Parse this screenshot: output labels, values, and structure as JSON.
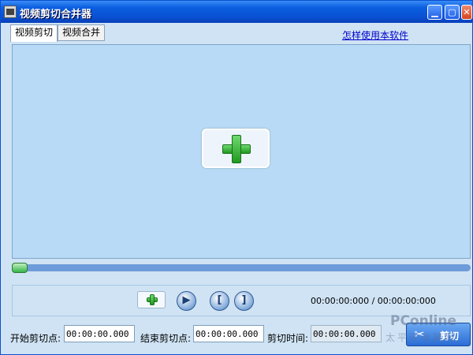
{
  "window": {
    "title": "视频剪切合并器",
    "minimize_glyph": "▁",
    "maximize_glyph": "▢",
    "close_glyph": "✕"
  },
  "tabs": [
    {
      "label": "视频剪切",
      "active": true
    },
    {
      "label": "视频合并",
      "active": false
    }
  ],
  "help_link": "怎样使用本软件",
  "video": {
    "add_icon": "plus-icon",
    "progress_fraction": 0.0
  },
  "controls": {
    "add_icon": "plus-icon",
    "play_glyph": "▶",
    "mark_start_glyph": "[",
    "mark_end_glyph": "]",
    "time_readout": "00:00:00:000 / 00:00:00:000"
  },
  "cut": {
    "start_label": "开始剪切点:",
    "start_value": "00:00:00.000",
    "end_label": "结束剪切点:",
    "end_value": "00:00:00.000",
    "duration_label": "剪切时间:",
    "duration_value": "00:00:00.000",
    "button_label": "剪切",
    "button_icon": "scissors-icon"
  },
  "watermark": {
    "main": "PConline",
    "sub": "太平洋电脑网"
  },
  "colors": {
    "titlebar": "#0a52d6",
    "video_bg": "#b8daf6",
    "progress": "#6e9bd9",
    "accent_green": "#1f9a1f"
  }
}
